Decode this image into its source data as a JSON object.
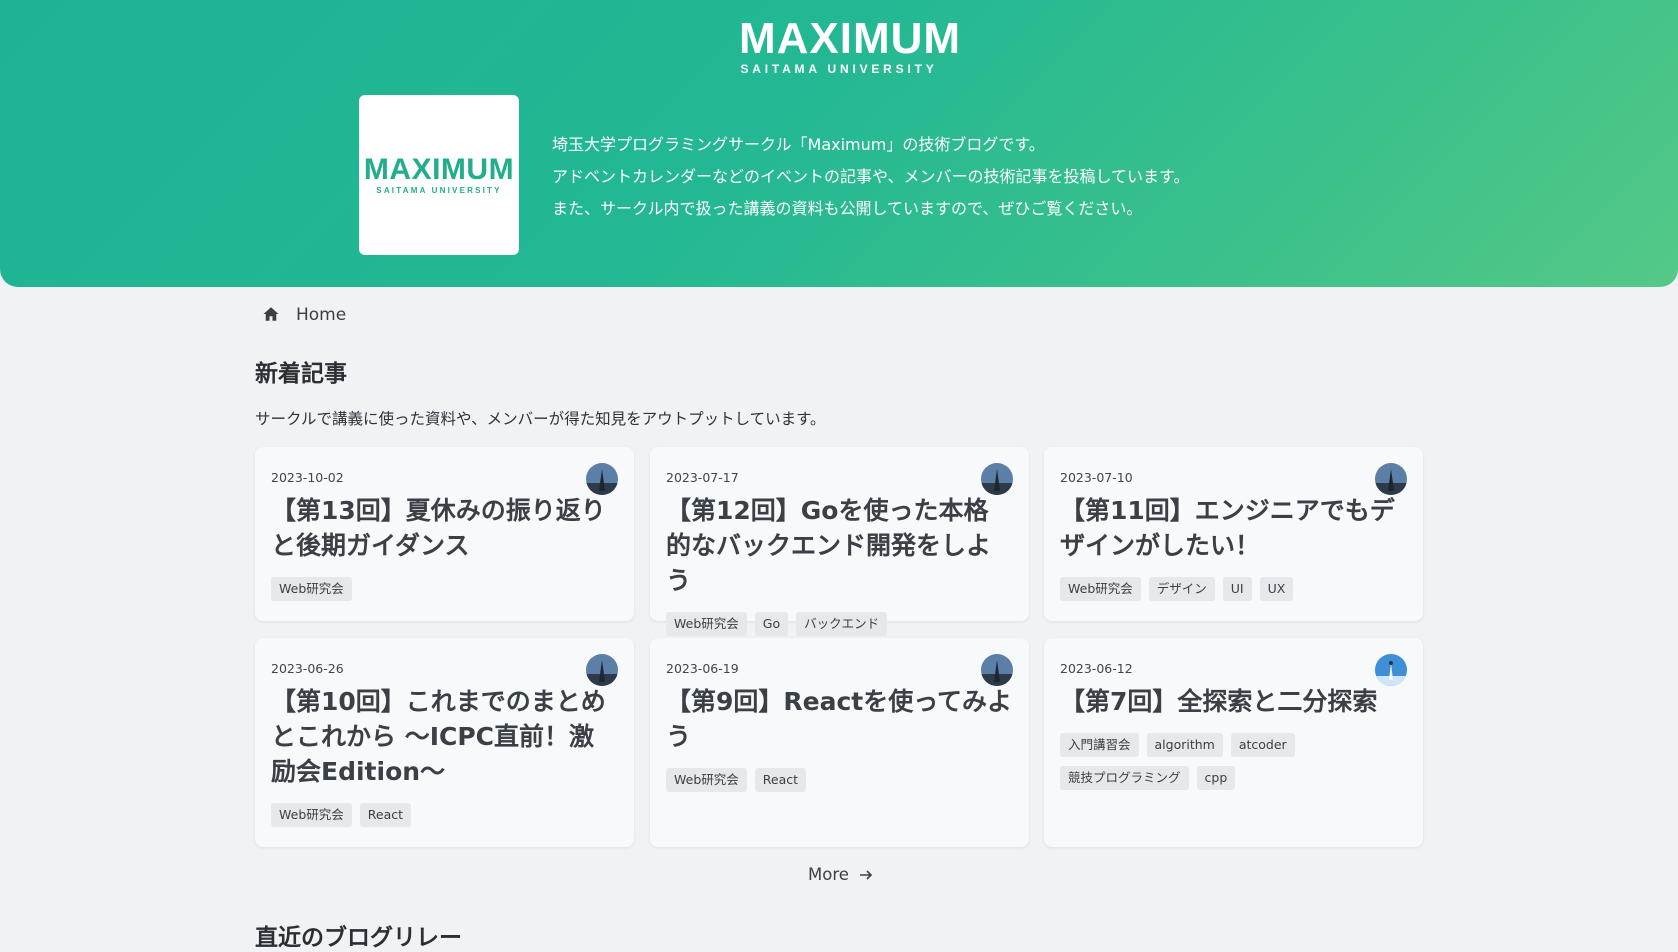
{
  "header": {
    "brand_name": "MAXIMUM",
    "brand_sub": "SAITAMA UNIVERSITY",
    "logo_name": "MAXIMUM",
    "logo_sub": "SAITAMA UNIVERSITY",
    "intro": [
      "埼玉大学プログラミングサークル「Maximum」の技術ブログです。",
      "アドベントカレンダーなどのイベントの記事や、メンバーの技術記事を投稿しています。",
      "また、サークル内で扱った講義の資料も公開していますので、ぜひご覧ください。"
    ],
    "gradient_from": "#1db394",
    "gradient_to": "#55c987"
  },
  "breadcrumb": {
    "icon": "home-icon",
    "label": "Home"
  },
  "latest": {
    "heading": "新着記事",
    "description": "サークルで講義に使った資料や、メンバーが得た知見をアウトプットしています。",
    "articles": [
      {
        "date": "2023-10-02",
        "title": "【第13回】夏休みの振り返りと後期ガイダンス",
        "tags": [
          "Web研究会"
        ],
        "avatar": "avatar-tower"
      },
      {
        "date": "2023-07-17",
        "title": "【第12回】Goを使った本格的なバックエンド開発をしよう",
        "tags": [
          "Web研究会",
          "Go",
          "バックエンド"
        ],
        "avatar": "avatar-tower"
      },
      {
        "date": "2023-07-10",
        "title": "【第11回】エンジニアでもデザインがしたい！",
        "tags": [
          "Web研究会",
          "デザイン",
          "UI",
          "UX"
        ],
        "avatar": "avatar-tower"
      },
      {
        "date": "2023-06-26",
        "title": "【第10回】これまでのまとめとこれから ～ICPC直前！激励会Edition～",
        "tags": [
          "Web研究会",
          "React"
        ],
        "avatar": "avatar-tower"
      },
      {
        "date": "2023-06-19",
        "title": "【第9回】Reactを使ってみよう",
        "tags": [
          "Web研究会",
          "React"
        ],
        "avatar": "avatar-tower"
      },
      {
        "date": "2023-06-12",
        "title": "【第7回】全探索と二分探索",
        "tags": [
          "入門講習会",
          "algorithm",
          "atcoder",
          "競技プログラミング",
          "cpp"
        ],
        "avatar": "avatar-sky"
      }
    ],
    "more_label": "More"
  },
  "relay": {
    "heading": "直近のブログリレー"
  }
}
